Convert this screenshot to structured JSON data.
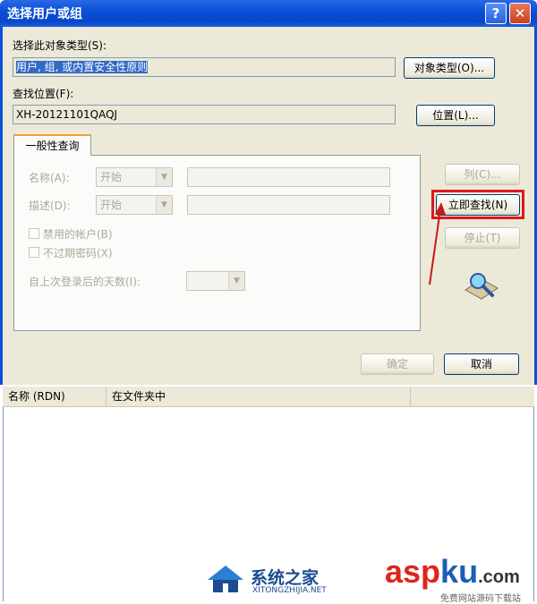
{
  "window": {
    "title": "选择用户或组"
  },
  "object_type": {
    "label": "选择此对象类型(S):",
    "value": "用户, 组, 或内置安全性原则",
    "button": "对象类型(O)..."
  },
  "location": {
    "label": "查找位置(F):",
    "value": "XH-20121101QAQJ",
    "button": "位置(L)..."
  },
  "tab": {
    "label": "一般性查询"
  },
  "query": {
    "name_label": "名称(A):",
    "name_mode": "开始",
    "desc_label": "描述(D):",
    "desc_mode": "开始",
    "disabled_accounts": "禁用的帐户(B)",
    "non_expiring": "不过期密码(X)",
    "days_label": "自上次登录后的天数(I):"
  },
  "side_buttons": {
    "columns": "列(C)...",
    "find_now": "立即查找(N)",
    "stop": "停止(T)"
  },
  "dialog_buttons": {
    "ok": "确定",
    "cancel": "取消"
  },
  "results": {
    "columns": [
      "名称 (RDN)",
      "在文件夹中"
    ]
  },
  "watermarks": {
    "site1_cn": "系统之家",
    "site1_en": "XITONGZHIJIA.NET",
    "site2_big": "aspku.com",
    "site2_sub": "免费网站源码下载站"
  },
  "colors": {
    "highlight_box": "#e0171f",
    "titlebar": "#0a4fd8"
  }
}
